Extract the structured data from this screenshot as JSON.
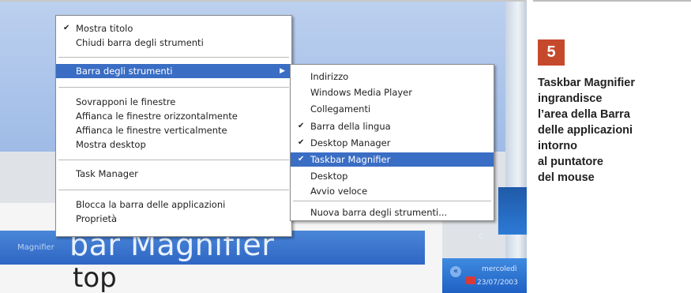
{
  "main_menu": {
    "items": [
      {
        "label": "Mostra titolo",
        "checked": true
      },
      {
        "label": "Chiudi barra degli strumenti",
        "checked": false
      },
      {
        "label": "Barra degli strumenti",
        "checked": false,
        "highlighted": true,
        "has_submenu": true
      },
      {
        "label": "Sovrapponi le finestre",
        "checked": false
      },
      {
        "label": "Affianca le finestre orizzontalmente",
        "checked": false
      },
      {
        "label": "Affianca le finestre verticalmente",
        "checked": false
      },
      {
        "label": "Mostra desktop",
        "checked": false
      },
      {
        "label": "Task Manager",
        "checked": false
      },
      {
        "label": "Blocca la barra delle applicazioni",
        "checked": false
      },
      {
        "label": "Proprietà",
        "checked": false
      }
    ]
  },
  "sub_menu": {
    "items": [
      {
        "label": "Indirizzo",
        "checked": false
      },
      {
        "label": "Windows Media Player",
        "checked": false
      },
      {
        "label": "Collegamenti",
        "checked": false
      },
      {
        "label": "Barra della lingua",
        "checked": true
      },
      {
        "label": "Desktop Manager",
        "checked": true
      },
      {
        "label": "Taskbar Magnifier",
        "checked": true,
        "highlighted": true
      },
      {
        "label": "Desktop",
        "checked": false
      },
      {
        "label": "Avvio veloce",
        "checked": false
      },
      {
        "label": "Nuova barra degli strumenti...",
        "checked": false
      }
    ]
  },
  "background": {
    "band_small": "Magnifier",
    "band_big": "bar Magnifier",
    "top_text": "top"
  },
  "tray": {
    "day": "mercoledì",
    "date": "23/07/2003",
    "edge_text": "c"
  },
  "side_panel": {
    "number": "5",
    "caption_lines": [
      "Taskbar Magnifier",
      "ingrandisce",
      "l’area della Barra",
      "delle applicazioni",
      "intorno",
      "al puntatore",
      "del mouse"
    ]
  },
  "colors": {
    "badge": "#c54a2c",
    "menu_highlight": "#3a6dc4",
    "taskbar_blue": "#2e66c4"
  }
}
